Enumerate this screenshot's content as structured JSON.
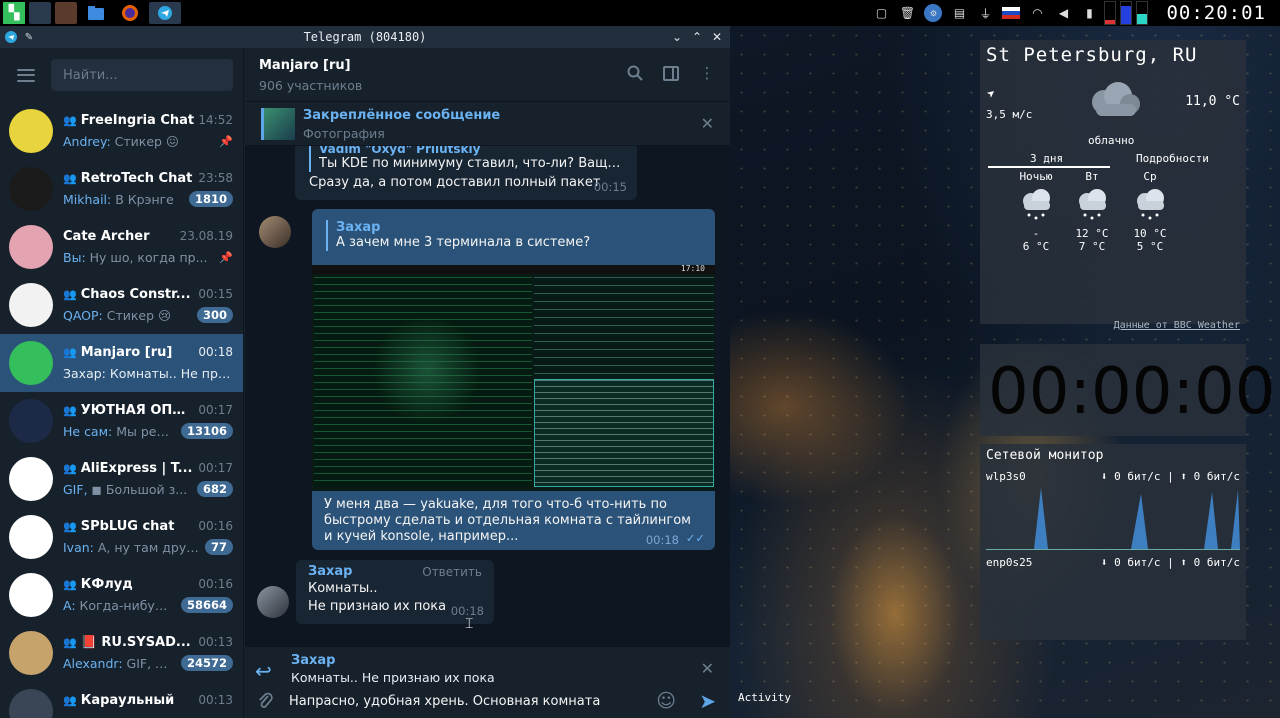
{
  "window": {
    "title": "Telegram (804180)"
  },
  "sidebar": {
    "search_placeholder": "Найти...",
    "chats": [
      {
        "name": "FreeIngria Chat",
        "group": true,
        "time": "14:52",
        "who": "Andrey:",
        "msg": " Стикер 😖",
        "badge": "",
        "pinned": true,
        "avatar_bg": "#e8d43c"
      },
      {
        "name": "RetroTech Chat",
        "group": true,
        "time": "23:58",
        "who": "Mikhail:",
        "msg": " В Крэнге",
        "badge": "1810",
        "pinned": false,
        "avatar_bg": "#1b1b1b"
      },
      {
        "name": "Cate Archer",
        "group": false,
        "time": "23.08.19",
        "who": "Вы:",
        "msg": " Ну шо, когда пр...",
        "badge": "",
        "pinned": true,
        "avatar_bg": "#e4a3b0"
      },
      {
        "name": "Chaos Constr...",
        "group": true,
        "time": "00:15",
        "who": "QAOP:",
        "msg": " Стикер 😢",
        "badge": "300",
        "pinned": false,
        "avatar_bg": "#f2f2f2"
      },
      {
        "name": "Manjaro [ru]",
        "group": true,
        "time": "00:18",
        "who": "Захар:",
        "msg": " Комнаты.. Не при...",
        "badge": "",
        "pinned": false,
        "avatar_bg": "#35bf5c",
        "active": true
      },
      {
        "name": "УЮТНАЯ ОПП...",
        "group": true,
        "time": "00:17",
        "who": "Не сам:",
        "msg": " Мы реш...",
        "badge": "13106",
        "pinned": false,
        "avatar_bg": "#1c2a48"
      },
      {
        "name": "AliExpress | T...",
        "group": true,
        "time": "00:17",
        "who": "GIF,",
        "msg": " ◼ Большой з...",
        "badge": "682",
        "pinned": false,
        "avatar_bg": "#ffffff"
      },
      {
        "name": "SPbLUG chat",
        "group": true,
        "time": "00:16",
        "who": "Ivan:",
        "msg": " А, ну там друг...",
        "badge": "77",
        "pinned": false,
        "avatar_bg": "#ffffff"
      },
      {
        "name": "КФлуд",
        "group": true,
        "time": "00:16",
        "who": "A:",
        "msg": " Когда-нибудь...",
        "badge": "58664",
        "pinned": false,
        "avatar_bg": "#ffffff"
      },
      {
        "name": "📕 RU.SYSAD...",
        "group": true,
        "time": "00:13",
        "who": "Alexandr:",
        "msg": " GIF, O...",
        "badge": "24572",
        "pinned": false,
        "avatar_bg": "#c7a36c"
      },
      {
        "name": "Караульный",
        "group": true,
        "time": "00:13",
        "who": "",
        "msg": "",
        "badge": "",
        "pinned": false,
        "avatar_bg": "#3a4656"
      }
    ]
  },
  "conversation": {
    "title": "Manjaro [ru]",
    "subtitle": "906 участников",
    "pinned_title": "Закреплённое сообщение",
    "pinned_sub": "Фотография",
    "msg1": {
      "author": "Vadim \"Oxyd\" Prilutskiy",
      "quote": "Ты KDE по минимуму ставил, что-ли? Ваще-т ...",
      "text": "Сразу да, а потом доставил полный пакет",
      "time": "00:15"
    },
    "msg2": {
      "quote_author": "Захар",
      "quote": "А зачем мне 3 терминала в системе?",
      "text": "У меня два — yakuake, для того что-б что-нить по быстрому сделать и отдельная комната с тайлингом и кучей konsole, например...",
      "time": "00:18",
      "shot_clock": "17:10"
    },
    "msg3": {
      "author": "Захар",
      "reply": "Ответить",
      "line1": "Комнаты..",
      "line2": "Не признаю их пока",
      "time": "00:18"
    },
    "reply_author": "Захар",
    "reply_text": "Комнаты.. Не признаю их пока",
    "draft": "Напрасно, удобная хрень. Основная комната"
  },
  "panel": {
    "clock": "00:20:01"
  },
  "weather": {
    "city": "St Petersburg, RU",
    "wind": "3,5 м/с",
    "temp": "11,0 °C",
    "condition": "облачно",
    "tab1": "3 дня",
    "tab2": "Подробности",
    "forecast": [
      {
        "day": "Ночью",
        "hi": "-",
        "lo": "6 °C"
      },
      {
        "day": "Вт",
        "hi": "12 °C",
        "lo": "7 °C"
      },
      {
        "day": "Ср",
        "hi": "10 °C",
        "lo": "5 °C"
      }
    ],
    "credit": "Данные от BBC Weather"
  },
  "timer": {
    "digits": "00:00:00"
  },
  "netmon": {
    "title": "Сетевой монитор",
    "if1": "wlp3s0",
    "if1_rate": "⬇ 0 бит/с | ⬆ 0 бит/с",
    "if2": "enp0s25",
    "if2_rate": "⬇ 0 бит/с | ⬆ 0 бит/с"
  },
  "desktop": {
    "activity": "Activity"
  },
  "colors": {
    "accent": "#2b5278",
    "link": "#6ab2f2",
    "badge": "#3e6a93"
  }
}
